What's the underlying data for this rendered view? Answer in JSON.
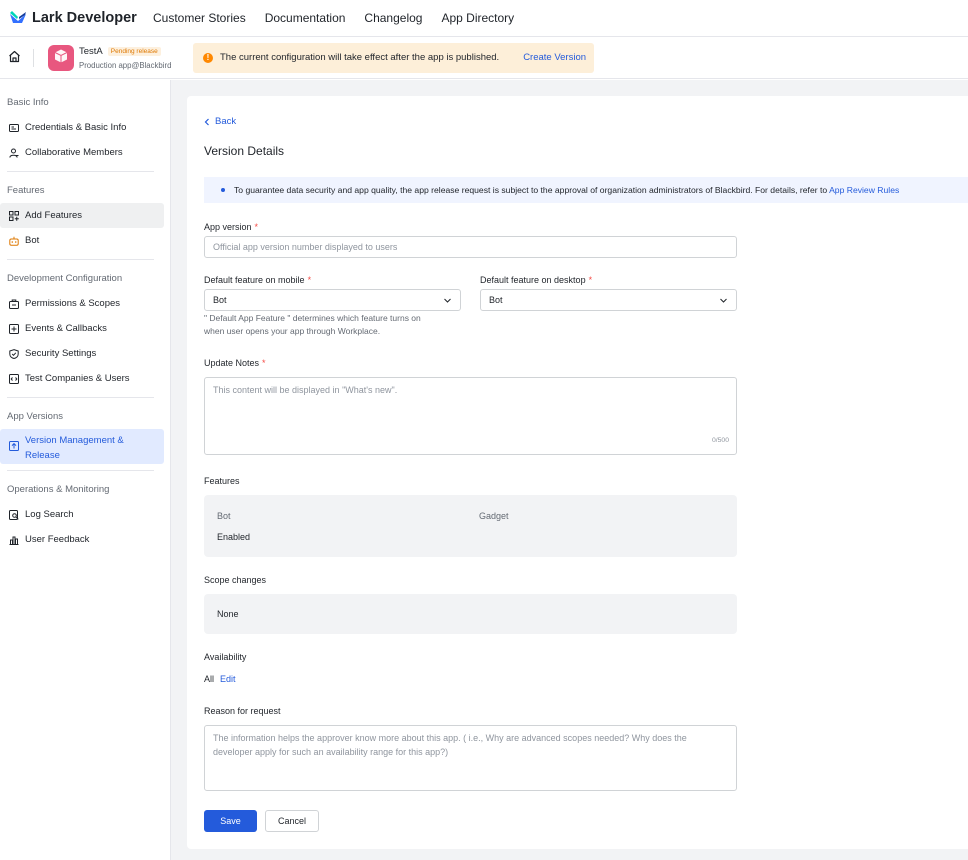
{
  "topnav": {
    "brand": "Lark Developer",
    "links": [
      "Customer Stories",
      "Documentation",
      "Changelog",
      "App Directory"
    ]
  },
  "appbar": {
    "app_name": "TestA",
    "status_badge": "Pending release",
    "app_subtitle": "Production app@Blackbird",
    "notice_text": "The current configuration will take effect after the app is published.",
    "notice_link": "Create Version"
  },
  "sidebar": {
    "groups": [
      {
        "title": "Basic Info",
        "items": [
          {
            "label": "Credentials & Basic Info",
            "icon": "id-card-icon"
          },
          {
            "label": "Collaborative Members",
            "icon": "members-icon"
          }
        ]
      },
      {
        "title": "Features",
        "items": [
          {
            "label": "Add Features",
            "icon": "grid-add-icon"
          },
          {
            "label": "Bot",
            "icon": "bot-icon"
          }
        ]
      },
      {
        "title": "Development Configuration",
        "items": [
          {
            "label": "Permissions & Scopes",
            "icon": "permission-icon"
          },
          {
            "label": "Events & Callbacks",
            "icon": "events-icon"
          },
          {
            "label": "Security Settings",
            "icon": "shield-icon"
          },
          {
            "label": "Test Companies & Users",
            "icon": "test-icon"
          }
        ]
      },
      {
        "title": "App Versions",
        "items": [
          {
            "label": "Version Management & Release",
            "icon": "upload-icon"
          }
        ]
      },
      {
        "title": "Operations & Monitoring",
        "items": [
          {
            "label": "Log Search",
            "icon": "log-icon"
          },
          {
            "label": "User Feedback",
            "icon": "feedback-icon"
          }
        ]
      }
    ]
  },
  "main": {
    "back_label": "Back",
    "title": "Version Details",
    "banner_text": "To guarantee data security and app quality, the app release request is subject to the approval of organization administrators of Blackbird. For details, refer to ",
    "banner_link": "App Review Rules",
    "app_version": {
      "label": "App version",
      "placeholder": "Official app version number displayed to users"
    },
    "mobile_feature": {
      "label": "Default feature on mobile",
      "value": "Bot",
      "hint_line1": "\" Default App Feature \" determines which feature turns on",
      "hint_line2": "when user opens your app through Workplace."
    },
    "desktop_feature": {
      "label": "Default feature on desktop",
      "value": "Bot"
    },
    "update_notes": {
      "label": "Update Notes",
      "placeholder": "This content will be displayed in \"What's new\".",
      "counter": "0/500"
    },
    "features": {
      "label": "Features",
      "col1_title": "Bot",
      "col1_status": "Enabled",
      "col2_title": "Gadget"
    },
    "scope_changes": {
      "label": "Scope changes",
      "value": "None"
    },
    "availability": {
      "label": "Availability",
      "value": "All",
      "edit": "Edit"
    },
    "reason": {
      "label": "Reason for request",
      "placeholder_line1": "The information helps the approver know more about this app. ( i.e., Why are advanced scopes needed? Why does the",
      "placeholder_line2": "developer apply for such an availability range for this app?)"
    },
    "save_label": "Save",
    "cancel_label": "Cancel"
  },
  "colors": {
    "accent": "#245bdb",
    "required": "#f54a45",
    "warning": "#ff8800",
    "app_icon": "#e8577f"
  }
}
